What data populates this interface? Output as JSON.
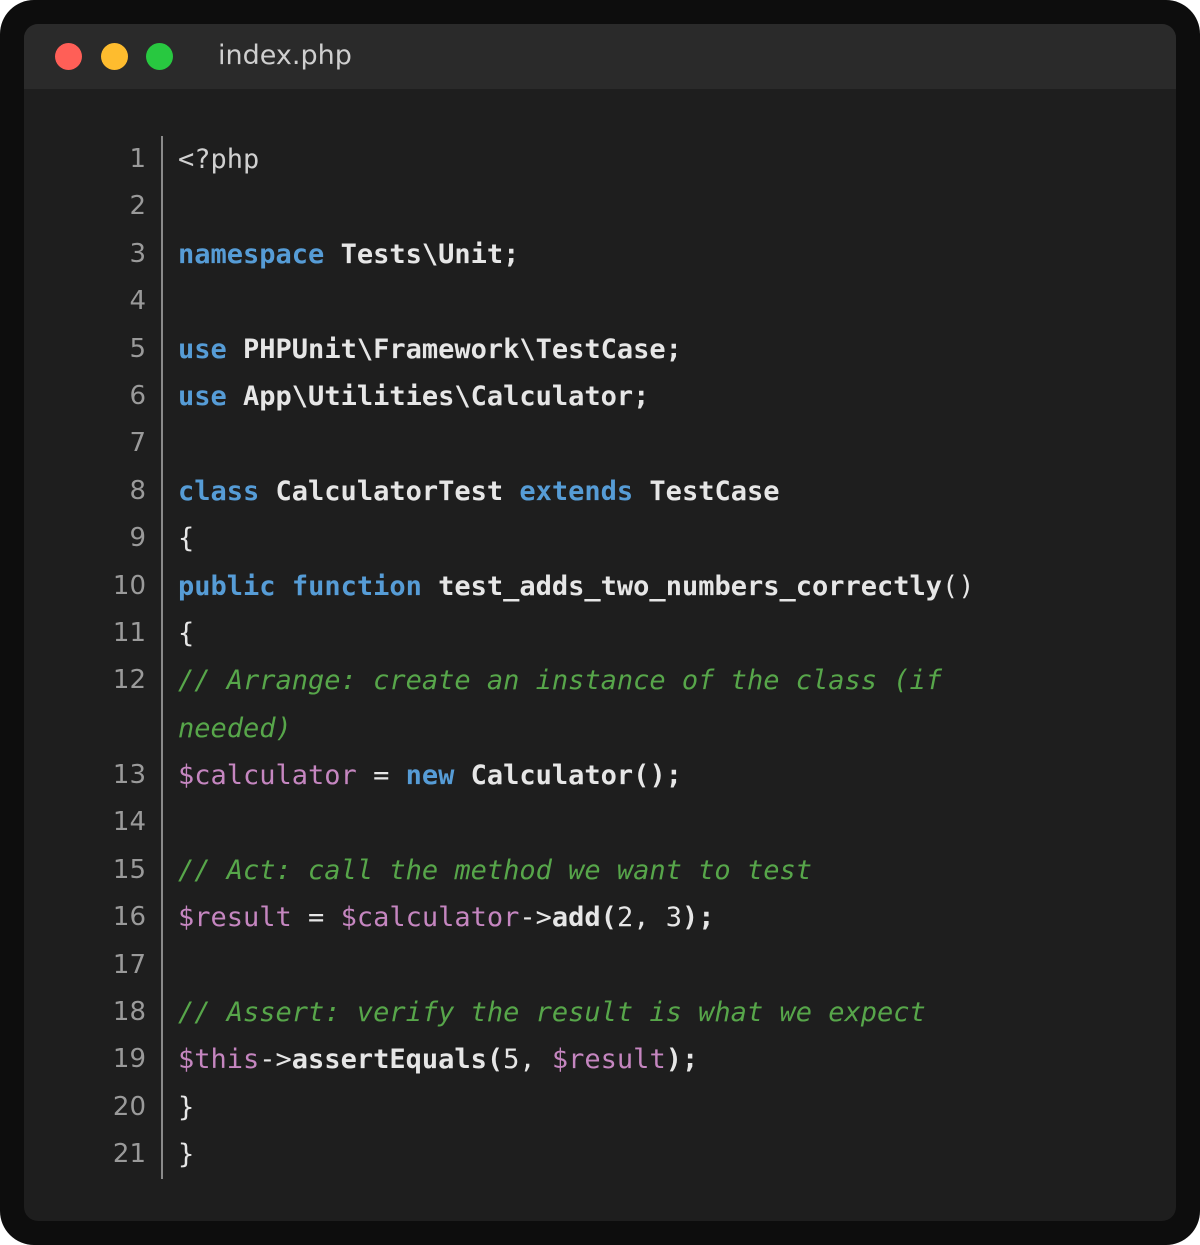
{
  "window": {
    "title": "index.php",
    "traffic_lights": [
      {
        "name": "close",
        "color": "#ff5f57"
      },
      {
        "name": "minimize",
        "color": "#febc2e"
      },
      {
        "name": "zoom",
        "color": "#28c840"
      }
    ]
  },
  "colors": {
    "background": "#1e1e1e",
    "titlebar": "#2a2a2a",
    "keyword": "#569cd6",
    "variable": "#c586c0",
    "comment": "#57a64a",
    "text": "#e6e6e6"
  },
  "editor": {
    "language": "php",
    "line_numbers": [
      "1",
      "2",
      "3",
      "4",
      "5",
      "6",
      "7",
      "8",
      "9",
      "10",
      "11",
      "12",
      "13",
      "14",
      "15",
      "16",
      "17",
      "18",
      "19",
      "20",
      "21"
    ],
    "lines": [
      [
        {
          "t": "tag",
          "v": "<?php"
        }
      ],
      [],
      [
        {
          "t": "kw",
          "v": "namespace"
        },
        {
          "t": "txt",
          "v": " Tests\\Unit;"
        }
      ],
      [],
      [
        {
          "t": "kw",
          "v": "use"
        },
        {
          "t": "txt",
          "v": " PHPUnit\\Framework\\TestCase;"
        }
      ],
      [
        {
          "t": "kw",
          "v": "use"
        },
        {
          "t": "txt",
          "v": " App\\Utilities\\Calculator;"
        }
      ],
      [],
      [
        {
          "t": "kw",
          "v": "class"
        },
        {
          "t": "txt",
          "v": " CalculatorTest "
        },
        {
          "t": "kw",
          "v": "extends"
        },
        {
          "t": "txt",
          "v": " TestCase"
        }
      ],
      [
        {
          "t": "punc",
          "v": "{"
        }
      ],
      [
        {
          "t": "kw",
          "v": "public"
        },
        {
          "t": "txt",
          "v": " "
        },
        {
          "t": "kw",
          "v": "function"
        },
        {
          "t": "txt",
          "v": " test_adds_two_numbers_correctly"
        },
        {
          "t": "punc",
          "v": "()"
        }
      ],
      [
        {
          "t": "punc",
          "v": "{"
        }
      ],
      [
        {
          "t": "cm",
          "v": "// Arrange: create an instance of the class (if needed)"
        }
      ],
      [
        {
          "t": "var",
          "v": "$calculator"
        },
        {
          "t": "punc",
          "v": " = "
        },
        {
          "t": "kw",
          "v": "new"
        },
        {
          "t": "txt",
          "v": " Calculator();"
        }
      ],
      [],
      [
        {
          "t": "cm",
          "v": "// Act: call the method we want to test"
        }
      ],
      [
        {
          "t": "var",
          "v": "$result"
        },
        {
          "t": "punc",
          "v": " = "
        },
        {
          "t": "var",
          "v": "$calculator"
        },
        {
          "t": "punc",
          "v": "->"
        },
        {
          "t": "txt",
          "v": "add("
        },
        {
          "t": "num",
          "v": "2, 3"
        },
        {
          "t": "txt",
          "v": ");"
        }
      ],
      [],
      [
        {
          "t": "cm",
          "v": "// Assert: verify the result is what we expect"
        }
      ],
      [
        {
          "t": "var",
          "v": "$this"
        },
        {
          "t": "punc",
          "v": "->"
        },
        {
          "t": "txt",
          "v": "assertEquals("
        },
        {
          "t": "num",
          "v": "5, "
        },
        {
          "t": "var",
          "v": "$result"
        },
        {
          "t": "txt",
          "v": ");"
        }
      ],
      [
        {
          "t": "punc",
          "v": "}"
        }
      ],
      [
        {
          "t": "punc",
          "v": "}"
        }
      ]
    ]
  }
}
